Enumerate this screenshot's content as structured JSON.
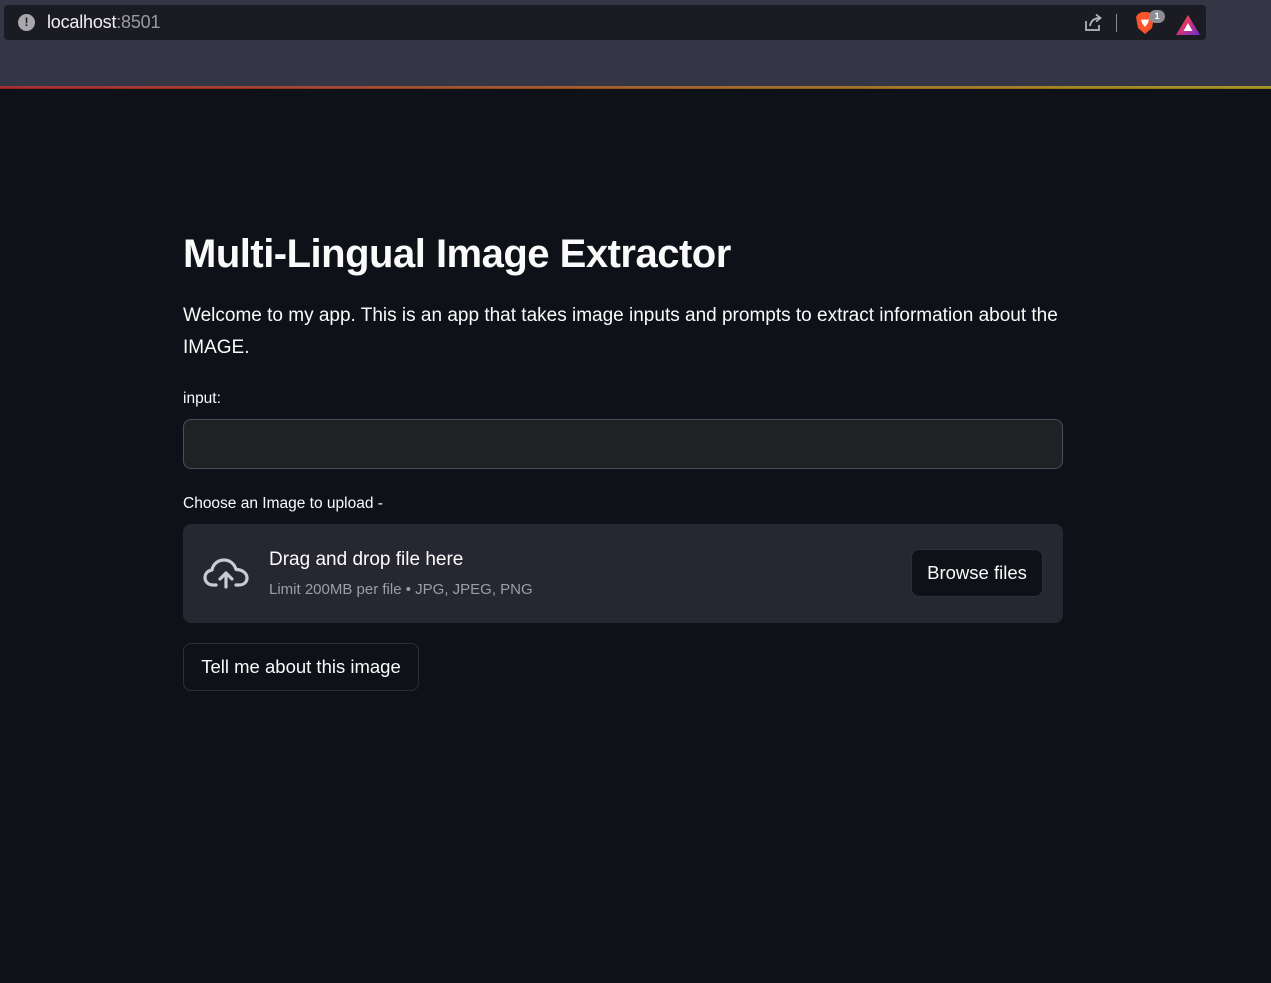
{
  "browser": {
    "url_host": "localhost",
    "url_port": ":8501",
    "shields_badge": "1",
    "icons": [
      "info-icon",
      "share-icon",
      "brave-shields-icon",
      "brave-rewards-icon"
    ]
  },
  "app": {
    "title": "Multi-Lingual Image Extractor",
    "description": "Welcome to my app. This is an app that takes image inputs and prompts to extract information about the IMAGE.",
    "input": {
      "label": "input:",
      "value": "",
      "placeholder": ""
    },
    "uploader": {
      "label": "Choose an Image to upload -",
      "drop_text": "Drag and drop file here",
      "limit_text": "Limit 200MB per file • JPG, JPEG, PNG",
      "browse_label": "Browse files",
      "icon": "cloud-upload-icon"
    },
    "submit_label": "Tell me about this image"
  },
  "colors": {
    "background": "#0e1117",
    "widget_bg": "#262730",
    "text": "#fafafa",
    "muted_text": "#9c9ea6",
    "chrome_bg": "#343545",
    "accent_gradient": [
      "#ff2b2b",
      "#ffe312"
    ]
  }
}
